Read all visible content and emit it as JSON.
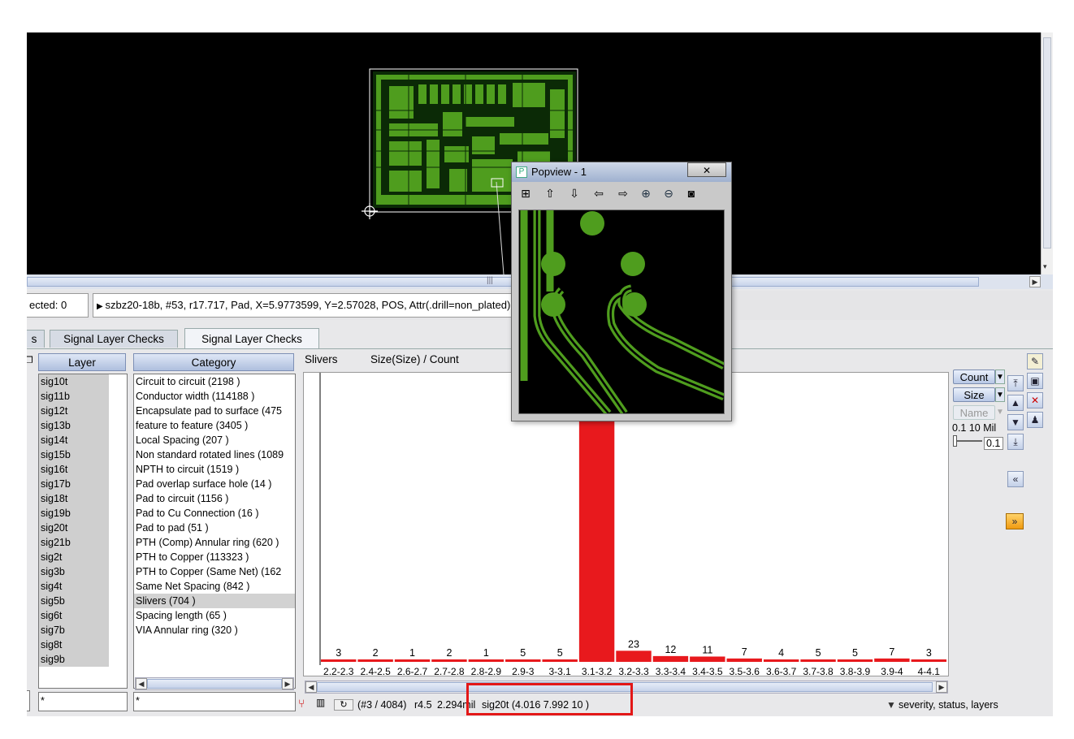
{
  "status": {
    "selected_label": "ected: 0",
    "info_text": "szbz20-18b, #53, r17.717, Pad, X=5.9773599, Y=2.57028, POS, Attr(.drill=non_plated)"
  },
  "tabs": [
    {
      "label": "s"
    },
    {
      "label": "Signal Layer Checks"
    },
    {
      "label": "Signal Layer Checks"
    }
  ],
  "layer_panel": {
    "header": "Layer",
    "filter_value": "*",
    "items": [
      "sig10t",
      "sig11b",
      "sig12t",
      "sig13b",
      "sig14t",
      "sig15b",
      "sig16t",
      "sig17b",
      "sig18t",
      "sig19b",
      "sig20t",
      "sig21b",
      "sig2t",
      "sig3b",
      "sig4t",
      "sig5b",
      "sig6t",
      "sig7b",
      "sig8t",
      "sig9b"
    ]
  },
  "category_panel": {
    "header": "Category",
    "filter_value": "*",
    "items": [
      "Circuit to circuit  (2198 )",
      "Conductor width  (114188 )",
      "Encapsulate pad to surface  (475",
      "feature to feature  (3405 )",
      "Local Spacing  (207 )",
      "Non standard rotated lines  (1089",
      "NPTH to circuit  (1519 )",
      "Pad overlap surface hole  (14 )",
      "Pad to circuit  (1156 )",
      "Pad to Cu Connection  (16 )",
      "Pad to pad  (51 )",
      "PTH (Comp) Annular ring  (620 )",
      "PTH to Copper  (113323 )",
      "PTH to Copper (Same Net)  (162",
      "Same Net Spacing  (842 )",
      "Slivers  (704 )",
      "Spacing length  (65 )",
      "VIA Annular ring  (320 )"
    ],
    "selected_index": 15
  },
  "chart_header": {
    "category": "Slivers",
    "metric": "Size(Size) / Count"
  },
  "chart_data": {
    "type": "bar",
    "categories": [
      "2.2-2.3",
      "2.4-2.5",
      "2.6-2.7",
      "2.7-2.8",
      "2.8-2.9",
      "2.9-3",
      "3-3.1",
      "3.1-3.2",
      "3.2-3.3",
      "3.3-3.4",
      "3.4-3.5",
      "3.5-3.6",
      "3.6-3.7",
      "3.7-3.8",
      "3.8-3.9",
      "3.9-4",
      "4-4.1"
    ],
    "values": [
      3,
      2,
      1,
      2,
      1,
      5,
      5,
      590,
      23,
      12,
      11,
      7,
      4,
      5,
      5,
      7,
      3
    ],
    "data_labels": [
      "3",
      "2",
      "1",
      "2",
      "1",
      "5",
      "5",
      "",
      "23",
      "12",
      "11",
      "7",
      "4",
      "5",
      "5",
      "7",
      "3"
    ],
    "color": "#e8191d"
  },
  "right_controls": {
    "count_label": "Count",
    "size_label": "Size",
    "name_label": "Name",
    "slider_caption": "0.1 10  Mil",
    "slider_value": "0.1",
    "slider_position": 0
  },
  "bottom_status": {
    "index_text": "(#3 / 4084)",
    "r_text": "r4.5",
    "size_text": "2.294mil",
    "layer_text": "sig20t  (4.016 7.992 10 )",
    "filter_text": "severity, status, layers"
  },
  "popview": {
    "title": "Popview - 1",
    "close_label": "✕"
  },
  "icons": {
    "canvas_toolbar": [
      "pencil-icon",
      "save-icon",
      "close-icon",
      "person-icon"
    ],
    "popview_toolbar": [
      "fit-icon",
      "move-up-icon",
      "move-down-icon",
      "move-left-icon",
      "move-right-icon",
      "zoom-in-icon",
      "zoom-out-icon",
      "camera-icon"
    ]
  },
  "colors": {
    "pcb_green": "#4f9d1e",
    "highlight_red": "#e8191d",
    "canvas_bg": "#000000"
  }
}
